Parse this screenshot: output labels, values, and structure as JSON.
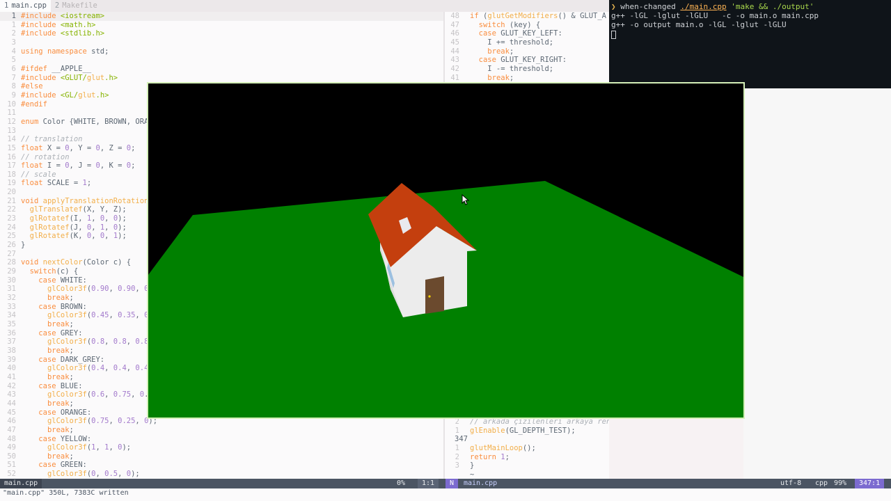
{
  "tabs": [
    {
      "num": "1",
      "label": "main.cpp",
      "active": true
    },
    {
      "num": "2",
      "label": "Makefile",
      "active": false
    }
  ],
  "left_lines": [
    {
      "n": "1",
      "code": "#include <iostream>",
      "cls": "pre"
    },
    {
      "n": "1",
      "code": "#include <math.h>",
      "cls": "pre"
    },
    {
      "n": "2",
      "code": "#include <stdlib.h>",
      "cls": "pre"
    },
    {
      "n": "3",
      "code": "",
      "cls": ""
    },
    {
      "n": "4",
      "code": "using namespace std;",
      "cls": ""
    },
    {
      "n": "5",
      "code": "",
      "cls": ""
    },
    {
      "n": "6",
      "code": "#ifdef __APPLE__",
      "cls": "pre"
    },
    {
      "n": "7",
      "code": "#include <GLUT/glut.h>",
      "cls": "pre"
    },
    {
      "n": "8",
      "code": "#else",
      "cls": "pre"
    },
    {
      "n": "9",
      "code": "#include <GL/glut.h>",
      "cls": "pre"
    },
    {
      "n": "10",
      "code": "#endif",
      "cls": "pre"
    },
    {
      "n": "11",
      "code": "",
      "cls": ""
    },
    {
      "n": "12",
      "code": "enum Color {WHITE, BROWN, ORA",
      "cls": ""
    },
    {
      "n": "13",
      "code": "",
      "cls": ""
    },
    {
      "n": "14",
      "code": "// translation",
      "cls": "comment"
    },
    {
      "n": "15",
      "code": "float X = 0, Y = 0, Z = 0;",
      "cls": ""
    },
    {
      "n": "16",
      "code": "// rotation",
      "cls": "comment"
    },
    {
      "n": "17",
      "code": "float I = 0, J = 0, K = 0;",
      "cls": ""
    },
    {
      "n": "18",
      "code": "// scale",
      "cls": "comment"
    },
    {
      "n": "19",
      "code": "float SCALE = 1;",
      "cls": ""
    },
    {
      "n": "20",
      "code": "",
      "cls": ""
    },
    {
      "n": "21",
      "code": "void applyTranslationRotation",
      "cls": ""
    },
    {
      "n": "22",
      "code": "  glTranslatef(X, Y, Z);",
      "cls": ""
    },
    {
      "n": "23",
      "code": "  glRotatef(I, 1, 0, 0);",
      "cls": ""
    },
    {
      "n": "24",
      "code": "  glRotatef(J, 0, 1, 0);",
      "cls": ""
    },
    {
      "n": "25",
      "code": "  glRotatef(K, 0, 0, 1);",
      "cls": ""
    },
    {
      "n": "26",
      "code": "}",
      "cls": ""
    },
    {
      "n": "27",
      "code": "",
      "cls": ""
    },
    {
      "n": "28",
      "code": "void nextColor(Color c) {",
      "cls": ""
    },
    {
      "n": "29",
      "code": "  switch(c) {",
      "cls": ""
    },
    {
      "n": "30",
      "code": "    case WHITE:",
      "cls": ""
    },
    {
      "n": "31",
      "code": "      glColor3f(0.90, 0.90, 0",
      "cls": ""
    },
    {
      "n": "32",
      "code": "      break;",
      "cls": ""
    },
    {
      "n": "33",
      "code": "    case BROWN:",
      "cls": ""
    },
    {
      "n": "34",
      "code": "      glColor3f(0.45, 0.35, 0",
      "cls": ""
    },
    {
      "n": "35",
      "code": "      break;",
      "cls": ""
    },
    {
      "n": "36",
      "code": "    case GREY:",
      "cls": ""
    },
    {
      "n": "37",
      "code": "      glColor3f(0.8, 0.8, 0.8",
      "cls": ""
    },
    {
      "n": "38",
      "code": "      break;",
      "cls": ""
    },
    {
      "n": "39",
      "code": "    case DARK_GREY:",
      "cls": ""
    },
    {
      "n": "40",
      "code": "      glColor3f(0.4, 0.4, 0.4",
      "cls": ""
    },
    {
      "n": "41",
      "code": "      break;",
      "cls": ""
    },
    {
      "n": "42",
      "code": "    case BLUE:",
      "cls": ""
    },
    {
      "n": "43",
      "code": "      glColor3f(0.6, 0.75, 0.",
      "cls": ""
    },
    {
      "n": "44",
      "code": "      break;",
      "cls": ""
    },
    {
      "n": "45",
      "code": "    case ORANGE:",
      "cls": ""
    },
    {
      "n": "46",
      "code": "      glColor3f(0.75, 0.25, 0);",
      "cls": ""
    },
    {
      "n": "47",
      "code": "      break;",
      "cls": ""
    },
    {
      "n": "48",
      "code": "    case YELLOW:",
      "cls": ""
    },
    {
      "n": "49",
      "code": "      glColor3f(1, 1, 0);",
      "cls": ""
    },
    {
      "n": "50",
      "code": "      break;",
      "cls": ""
    },
    {
      "n": "51",
      "code": "    case GREEN:",
      "cls": ""
    },
    {
      "n": "52",
      "code": "      glColor3f(0, 0.5, 0);",
      "cls": ""
    }
  ],
  "right_top_lines": [
    {
      "n": "48",
      "code": "if (glutGetModifiers() & GLUT_A"
    },
    {
      "n": "47",
      "code": "  switch (key) {"
    },
    {
      "n": "46",
      "code": "  case GLUT_KEY_LEFT:"
    },
    {
      "n": "45",
      "code": "    I += threshold;"
    },
    {
      "n": "44",
      "code": "    break;"
    },
    {
      "n": "43",
      "code": "  case GLUT_KEY_RIGHT:"
    },
    {
      "n": "42",
      "code": "    I -= threshold;"
    },
    {
      "n": "41",
      "code": "    break;"
    }
  ],
  "right_bottom_lines": [
    {
      "n": "2",
      "code": "// arkada çizilenleri arkaya render etmek için",
      "cur": false
    },
    {
      "n": "1",
      "code": "glEnable(GL_DEPTH_TEST);",
      "cur": false
    },
    {
      "n": "347",
      "code": "",
      "cur": true
    },
    {
      "n": "1",
      "code": "glutMainLoop();",
      "cur": false
    },
    {
      "n": "2",
      "code": "return 1;",
      "cur": false
    },
    {
      "n": "3",
      "code": "}",
      "cur": false
    },
    {
      "n": "",
      "code": "~",
      "cur": false
    }
  ],
  "terminal": {
    "prompt": "❯",
    "cmd": "when-changed",
    "path": "./main.cpp",
    "arg": "'make && ./output'",
    "out1": "g++ -lGL -lglut -lGLU   -c -o main.o main.cpp",
    "out2": "g++ -o output main.o -lGL -lglut -lGLU"
  },
  "statusbar": {
    "left_file": "main.cpp",
    "percent": "0%",
    "pos": "1:1",
    "mode": "N",
    "right_file": "main.cpp",
    "encoding": "utf-8",
    "filetype": "cpp",
    "right_percent": "99%",
    "right_pos": "347:1"
  },
  "cmdline": "\"main.cpp\" 350L, 7383C written",
  "scene_colors": {
    "background": "#000000",
    "ground": "#008000",
    "roof": "#c43f0e",
    "walls": "#ececec",
    "door": "#6b4a2e",
    "window": "#9cc0e0",
    "knob": "#ffd700"
  }
}
